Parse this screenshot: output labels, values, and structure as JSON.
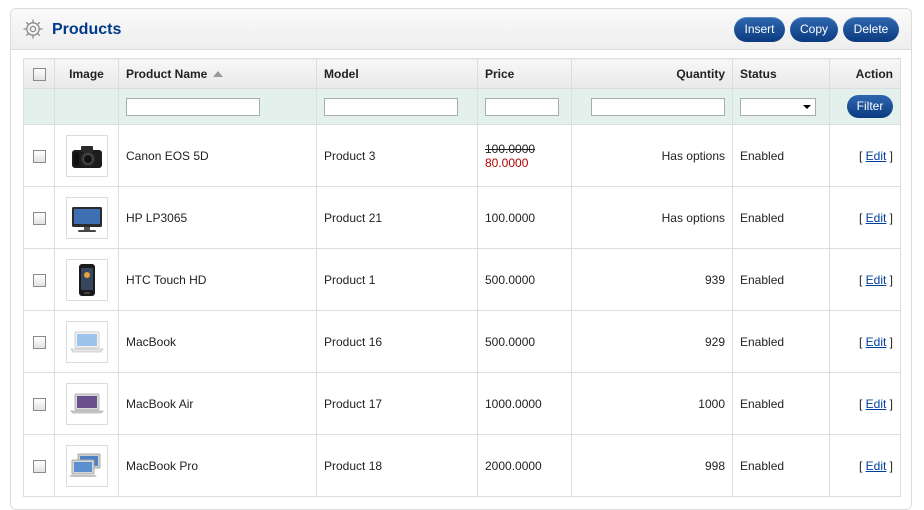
{
  "header": {
    "title": "Products",
    "buttons": {
      "insert": "Insert",
      "copy": "Copy",
      "delete": "Delete"
    }
  },
  "columns": {
    "image": "Image",
    "name": "Product Name",
    "model": "Model",
    "price": "Price",
    "quantity": "Quantity",
    "status": "Status",
    "action": "Action"
  },
  "filter": {
    "name": "",
    "model": "",
    "price": "",
    "quantity": "",
    "status": "",
    "button": "Filter"
  },
  "rows": [
    {
      "icon": "camera-icon",
      "name": "Canon EOS 5D",
      "model": "Product 3",
      "price": "100.0000",
      "special": "80.0000",
      "quantity": "Has options",
      "status": "Enabled",
      "edit": "Edit"
    },
    {
      "icon": "monitor-icon",
      "name": "HP LP3065",
      "model": "Product 21",
      "price": "100.0000",
      "special": "",
      "quantity": "Has options",
      "status": "Enabled",
      "edit": "Edit"
    },
    {
      "icon": "phone-icon",
      "name": "HTC Touch HD",
      "model": "Product 1",
      "price": "500.0000",
      "special": "",
      "quantity": "939",
      "status": "Enabled",
      "edit": "Edit"
    },
    {
      "icon": "laptop-icon",
      "name": "MacBook",
      "model": "Product 16",
      "price": "500.0000",
      "special": "",
      "quantity": "929",
      "status": "Enabled",
      "edit": "Edit"
    },
    {
      "icon": "laptop-icon",
      "name": "MacBook Air",
      "model": "Product 17",
      "price": "1000.0000",
      "special": "",
      "quantity": "1000",
      "status": "Enabled",
      "edit": "Edit"
    },
    {
      "icon": "laptop-icon",
      "name": "MacBook Pro",
      "model": "Product 18",
      "price": "2000.0000",
      "special": "",
      "quantity": "998",
      "status": "Enabled",
      "edit": "Edit"
    }
  ],
  "colors": {
    "accent": "#0b3a80",
    "title": "#003a88",
    "special_price": "#b00000",
    "has_options": "#eda019",
    "in_stock": "#2b8a0a",
    "filter_row": "#e3f0ec"
  }
}
